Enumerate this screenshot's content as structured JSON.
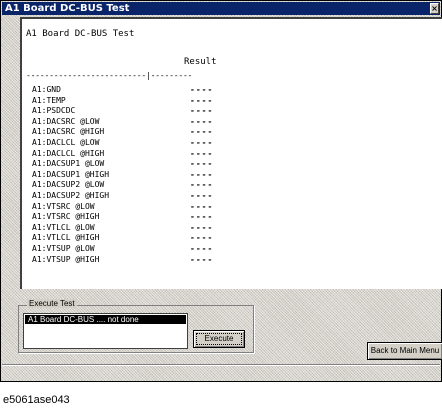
{
  "window": {
    "title": "A1 Board DC-BUS Test",
    "close_glyph": "×"
  },
  "results": {
    "heading": "A1 Board DC-BUS Test",
    "column_header": "Result",
    "divider": "--------------------------|---------",
    "rows": [
      {
        "name": "A1:GND",
        "result": "----"
      },
      {
        "name": "A1:TEMP",
        "result": "----"
      },
      {
        "name": "A1:PSDCDC",
        "result": "----"
      },
      {
        "name": "A1:DACSRC @LOW",
        "result": "----"
      },
      {
        "name": "A1:DACSRC @HIGH",
        "result": "----"
      },
      {
        "name": "A1:DACLCL @LOW",
        "result": "----"
      },
      {
        "name": "A1:DACLCL @HIGH",
        "result": "----"
      },
      {
        "name": "A1:DACSUP1 @LOW",
        "result": "----"
      },
      {
        "name": "A1:DACSUP1 @HIGH",
        "result": "----"
      },
      {
        "name": "A1:DACSUP2 @LOW",
        "result": "----"
      },
      {
        "name": "A1:DACSUP2 @HIGH",
        "result": "----"
      },
      {
        "name": "A1:VTSRC @LOW",
        "result": "----"
      },
      {
        "name": "A1:VTSRC @HIGH",
        "result": "----"
      },
      {
        "name": "A1:VTLCL @LOW",
        "result": "----"
      },
      {
        "name": "A1:VTLCL @HIGH",
        "result": "----"
      },
      {
        "name": "A1:VTSUP @LOW",
        "result": "----"
      },
      {
        "name": "A1:VTSUP @HIGH",
        "result": "----"
      }
    ]
  },
  "execute": {
    "group_label": "Execute Test",
    "list_item": "A1 Board DC-BUS .... not done",
    "button_label": "Execute"
  },
  "back_button_label": "Back to Main Menu",
  "caption": "e5061ase043"
}
